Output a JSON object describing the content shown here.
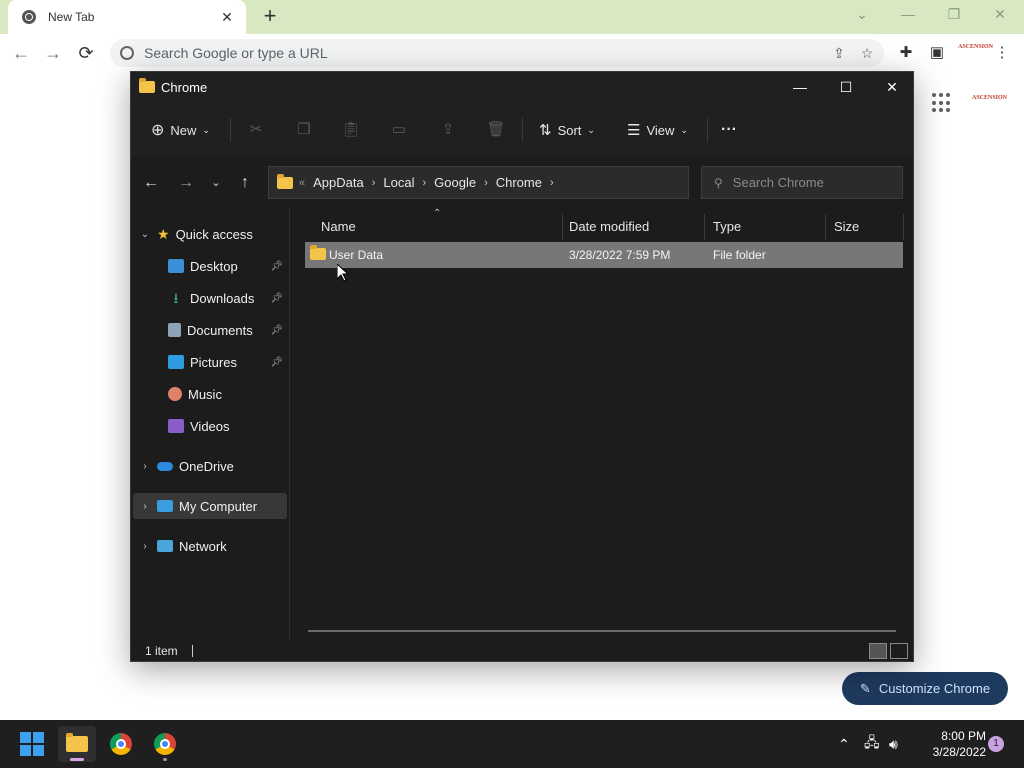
{
  "browser": {
    "tab_title": "New Tab",
    "tab_close": "✕",
    "new_tab": "+",
    "omnibox_placeholder": "Search Google or type a URL",
    "profile_label": "ASCENSION",
    "customize_label": "Customize Chrome",
    "window_controls": {
      "dropdown": "⌄",
      "minimize": "—",
      "restore": "❐",
      "close": "✕"
    }
  },
  "explorer": {
    "title": "Chrome",
    "window_controls": {
      "minimize": "—",
      "maximize": "☐",
      "close": "✕"
    },
    "commands": {
      "new_label": "New",
      "sort_label": "Sort",
      "view_label": "View",
      "more_label": "···"
    },
    "address": {
      "overflow": "«",
      "crumbs": [
        "AppData",
        "Local",
        "Google",
        "Chrome"
      ]
    },
    "search_placeholder": "Search Chrome",
    "nav": {
      "quick_access": "Quick access",
      "items": [
        {
          "label": "Desktop",
          "icon": "desktop-icon",
          "color": "#3a8fd8",
          "pinned": true
        },
        {
          "label": "Downloads",
          "icon": "download-icon",
          "color": "#36b37e",
          "pinned": true
        },
        {
          "label": "Documents",
          "icon": "documents-icon",
          "color": "#8fa3b8",
          "pinned": true
        },
        {
          "label": "Pictures",
          "icon": "pictures-icon",
          "color": "#2e9ce0",
          "pinned": true
        },
        {
          "label": "Music",
          "icon": "music-icon",
          "color": "#e0826a",
          "pinned": false
        },
        {
          "label": "Videos",
          "icon": "videos-icon",
          "color": "#8a5cc9",
          "pinned": false
        }
      ],
      "onedrive": "OneDrive",
      "my_computer": "My Computer",
      "network": "Network"
    },
    "columns": {
      "name": "Name",
      "date": "Date modified",
      "type": "Type",
      "size": "Size"
    },
    "rows": [
      {
        "name": "User Data",
        "date": "3/28/2022 7:59 PM",
        "type": "File folder",
        "size": ""
      }
    ],
    "status": "1 item"
  },
  "taskbar": {
    "time": "8:00 PM",
    "date": "3/28/2022",
    "notifications": "1"
  }
}
